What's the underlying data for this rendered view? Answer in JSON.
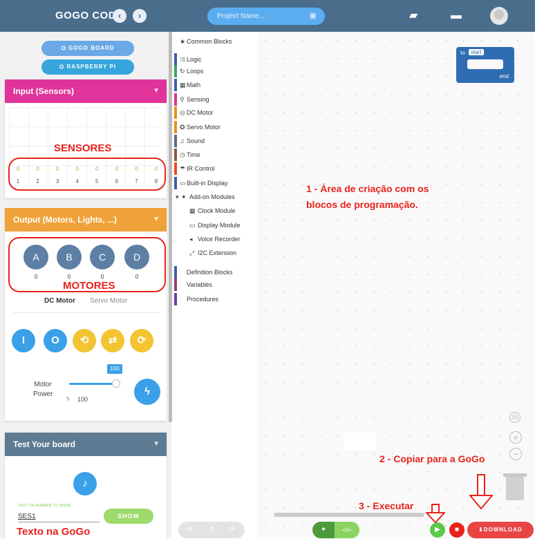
{
  "header": {
    "brand": "GOGO CODE",
    "back_icon": "‹",
    "forward_icon": "›",
    "project_placeholder": "Project Name...",
    "save_icon": "▣",
    "book_icon": "▰",
    "folder_icon": "▬"
  },
  "left": {
    "gogo_board": "⛭ GOGO BOARD",
    "raspberry_pi": "⛭ RASPBERRY PI",
    "input": {
      "title": "Input (Sensors)",
      "values": [
        "0",
        "0",
        "0",
        "0",
        "0",
        "0",
        "0",
        "0"
      ],
      "ports": [
        "1",
        "2",
        "3",
        "4",
        "5",
        "6",
        "7",
        "8"
      ]
    },
    "sensores_label": "SENSORES",
    "output": {
      "title": "Output (Motors, Lights, ...)",
      "motors": [
        {
          "label": "A",
          "value": "0"
        },
        {
          "label": "B",
          "value": "0"
        },
        {
          "label": "C",
          "value": "0"
        },
        {
          "label": "D",
          "value": "0"
        }
      ],
      "tab_dc": "DC Motor",
      "tab_servo": "Servo Motor",
      "motor_power_label": "Motor\nPower",
      "power_badge": "100",
      "power_value": "100"
    },
    "motores_label": "MOTORES",
    "test": {
      "title": "Test Your board",
      "text_label": "TEXT OR NUMBER TO SHOW",
      "text_value": "SES1",
      "show_button": "SHOW"
    },
    "texto_label": "Texto na GoGo"
  },
  "categories": [
    {
      "label": "Common Blocks",
      "icon": "★",
      "color": "#ffffff"
    },
    {
      "label": "Logic",
      "icon": "⤨",
      "color": "#3b5fa8"
    },
    {
      "label": "Loops",
      "icon": "↻",
      "color": "#3aa65c"
    },
    {
      "label": "Math",
      "icon": "▦",
      "color": "#3b5fa8"
    },
    {
      "label": "Sensing",
      "icon": "⚲",
      "color": "#d9368b"
    },
    {
      "label": "DC Motor",
      "icon": "◎",
      "color": "#e8911a"
    },
    {
      "label": "Servo Motor",
      "icon": "✪",
      "color": "#e8911a"
    },
    {
      "label": "Sound",
      "icon": "♫",
      "color": "#5c6d80"
    },
    {
      "label": "Time",
      "icon": "◷",
      "color": "#8a5a3c"
    },
    {
      "label": "IR Control",
      "icon": "☂",
      "color": "#e84f1c"
    },
    {
      "label": "Built-in Display",
      "icon": "▭",
      "color": "#3b5fa8"
    },
    {
      "label": "Add-on Modules",
      "icon": "▾",
      "color": "#ffffff"
    },
    {
      "label": "Clock Module",
      "icon": "▦",
      "color": "#ffffff"
    },
    {
      "label": "Display Module",
      "icon": "▭",
      "color": "#ffffff"
    },
    {
      "label": "Voice Recorder",
      "icon": "◂",
      "color": "#ffffff"
    },
    {
      "label": "I2C Extension",
      "icon": "⤢",
      "color": "#ffffff"
    },
    {
      "label": "Definition Blocks",
      "icon": "",
      "color": "#3b5fa8"
    },
    {
      "label": "Variables",
      "icon": "",
      "color": "#8d3f7a"
    },
    {
      "label": "Procedures",
      "icon": "",
      "color": "#6b3fa0"
    }
  ],
  "workspace": {
    "block_to": "to",
    "block_start": "start",
    "block_end": "end",
    "annotation_1": "1 - Área de criação com os\nblocos de programação.",
    "annotation_2": "2 - Copiar para a GoGo",
    "annotation_3": "3 - Executar",
    "download_label": "⬇DOWNLOAD"
  }
}
